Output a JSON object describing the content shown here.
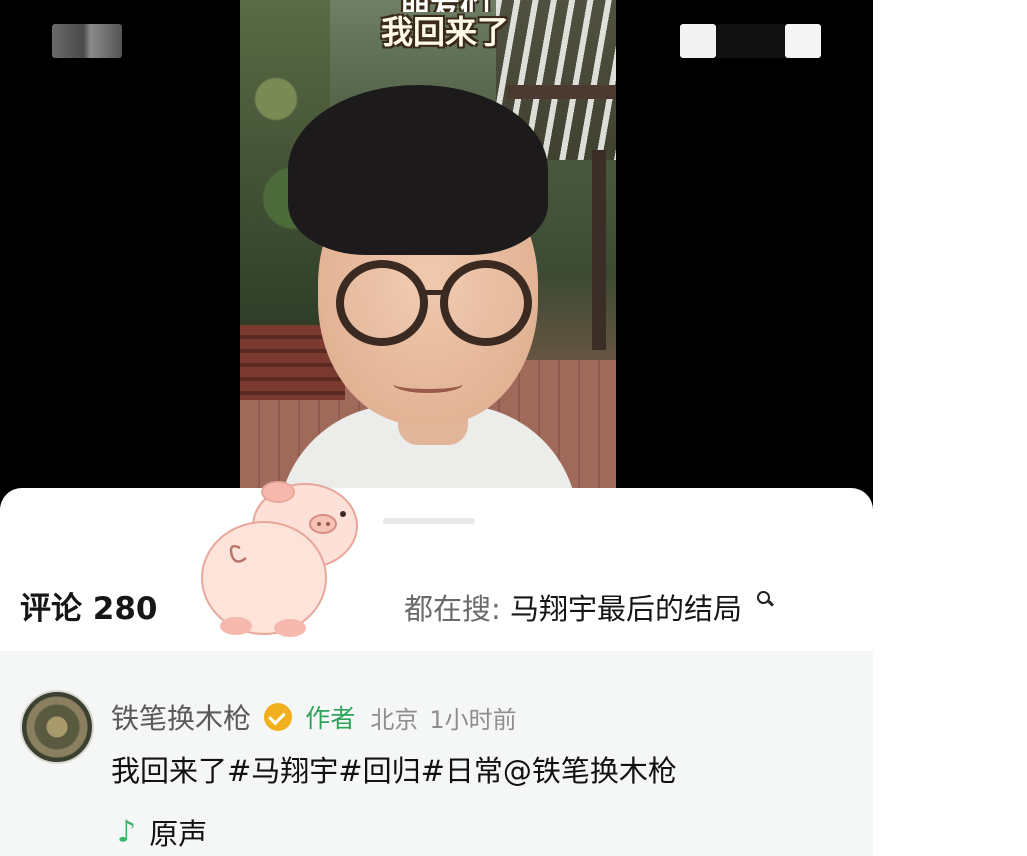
{
  "status_bar": {
    "left_block": "blurred",
    "right_blocks": "blurred"
  },
  "video": {
    "caption_line1": "朋友们",
    "caption_line2": "我回来了"
  },
  "comments_panel": {
    "count_label": "评论",
    "count": "280",
    "search_prefix": "都在搜:",
    "search_query": "马翔宇最后的结局"
  },
  "comment": {
    "author": "铁笔换木枪",
    "badge": "作者",
    "location": "北京",
    "time": "1小时前",
    "text": "我回来了#马翔宇#回归#日常@铁笔换木枪",
    "music_icon": "♪",
    "music_label": "原声"
  },
  "colors": {
    "accent_green": "#2fa35a",
    "verified_gold": "#f2b01e",
    "music_green": "#39b46a"
  }
}
